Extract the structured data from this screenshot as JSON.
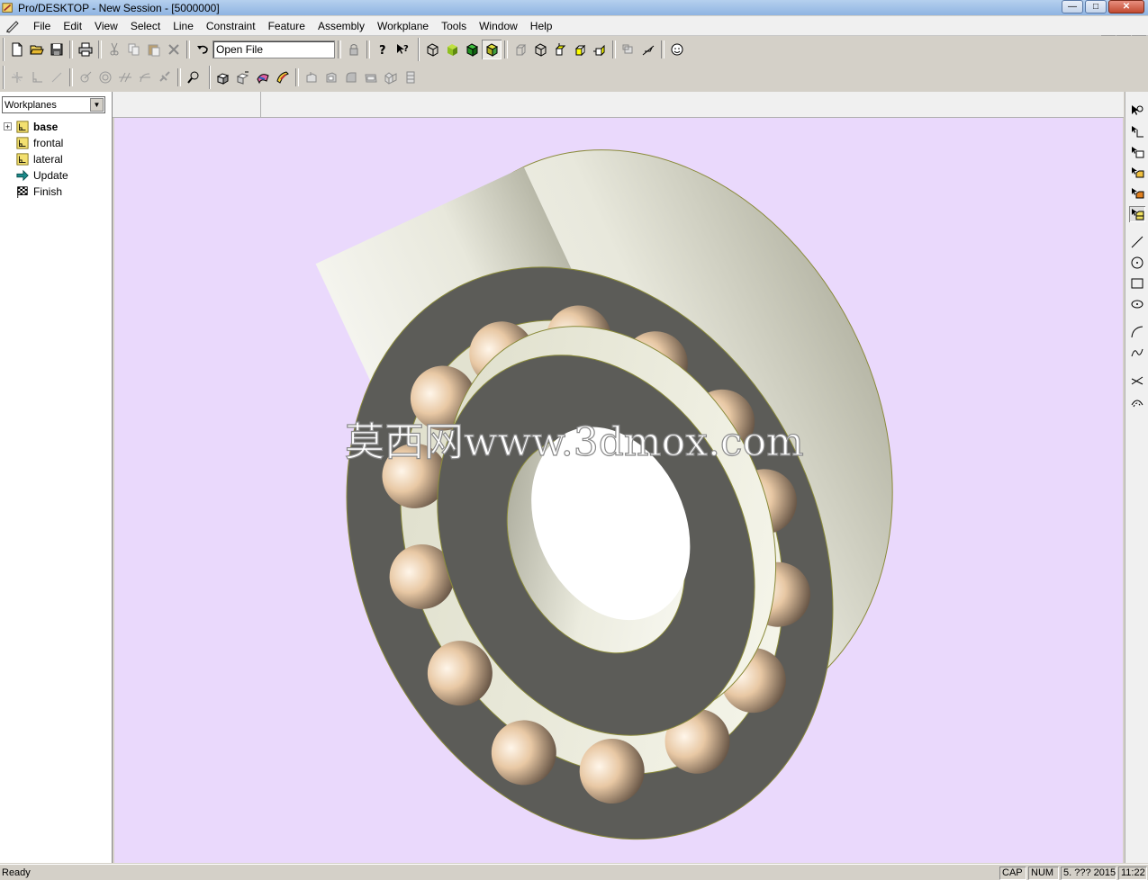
{
  "window": {
    "title": "Pro/DESKTOP - New Session - [5000000]",
    "minimize": "—",
    "maximize": "□",
    "close": "✕"
  },
  "mdi": {
    "minimize": "_",
    "restore": "❐",
    "close": "×"
  },
  "menu": [
    "File",
    "Edit",
    "View",
    "Select",
    "Line",
    "Constraint",
    "Feature",
    "Assembly",
    "Workplane",
    "Tools",
    "Window",
    "Help"
  ],
  "toolbar": {
    "open_file_combo": "Open File",
    "icons_row1": [
      "new-icon",
      "open-icon",
      "save-icon",
      "print-icon",
      "cut-icon",
      "copy-icon",
      "paste-icon",
      "delete-icon",
      "undo-icon",
      "help-icon",
      "context-help-icon",
      "wireframe-view-icon",
      "shaded-view-icon",
      "shaded-edges-view-icon",
      "shaded-outline-view-icon",
      "front-view-icon",
      "isometric-view-icon",
      "top-view-icon",
      "right-view-icon",
      "back-view-icon",
      "zoom-box-icon",
      "pan-icon",
      "smiley-icon"
    ],
    "icons_row2": [
      "constraint-icon",
      "perpendicular-icon",
      "line-icon",
      "angle-icon",
      "concentric-icon",
      "parallel-icon",
      "tangent-icon",
      "link-icon",
      "zoom-icon",
      "extrude-icon",
      "revolve-icon",
      "sweep-icon",
      "loft-icon",
      "chamfer-icon",
      "shell-icon",
      "fillet-icon",
      "draft-icon",
      "pattern-icon",
      "mirror-icon"
    ]
  },
  "left_panel": {
    "selector": "Workplanes",
    "tree": [
      {
        "label": "base",
        "bold": true,
        "icon": "workplane-icon",
        "expander": "+"
      },
      {
        "label": "frontal",
        "bold": false,
        "icon": "workplane-icon"
      },
      {
        "label": "lateral",
        "bold": false,
        "icon": "workplane-icon"
      },
      {
        "label": "Update",
        "bold": false,
        "icon": "update-arrow-icon"
      },
      {
        "label": "Finish",
        "bold": false,
        "icon": "finish-flag-icon"
      }
    ]
  },
  "viewport": {
    "background": "#ead9fc",
    "watermark": "莫西网www.3dmox.com",
    "model": "ball-bearing"
  },
  "right_toolbar": [
    "select-workplane-icon",
    "select-sketch-icon",
    "select-line-icon",
    "select-face-icon",
    "select-edge-icon",
    "select-feature-icon",
    "draw-line-icon",
    "draw-circle-icon",
    "draw-rectangle-icon",
    "draw-ellipse-icon",
    "draw-arc-icon",
    "draw-spline-icon",
    "trim-icon",
    "offset-icon"
  ],
  "status": {
    "text": "Ready",
    "cap": "CAP",
    "num": "NUM",
    "date": "5. ??? 2015",
    "time": "11:22"
  }
}
